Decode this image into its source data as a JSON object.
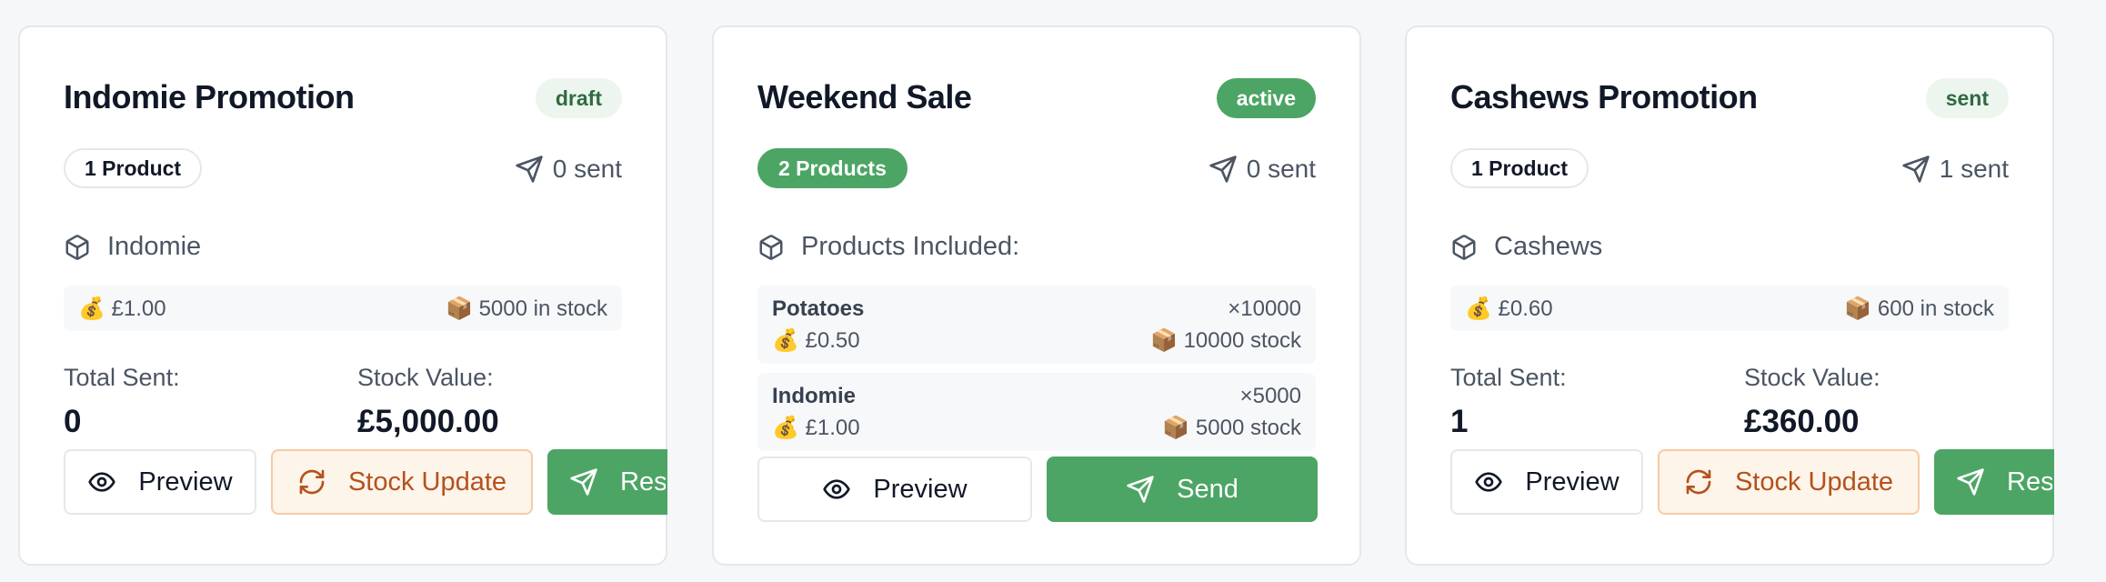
{
  "campaigns": [
    {
      "title": "Indomie Promotion",
      "status": "draft",
      "product_count": "1 Product",
      "sent": "0 sent",
      "product_name": "Indomie",
      "price": "💰 £1.00",
      "stock": "📦 5000 in stock",
      "total_sent_label": "Total Sent:",
      "total_sent": "0",
      "stock_value_label": "Stock Value:",
      "stock_value": "£5,000.00",
      "buttons": {
        "preview": "Preview",
        "stock_update": "Stock Update",
        "resend": "Resend"
      }
    },
    {
      "title": "Weekend Sale",
      "status": "active",
      "product_count": "2 Products",
      "sent": "0 sent",
      "products_label": "Products Included:",
      "products": [
        {
          "name": "Potatoes",
          "qty": "×10000",
          "price": "💰 £0.50",
          "stock": "📦 10000 stock"
        },
        {
          "name": "Indomie",
          "qty": "×5000",
          "price": "💰 £1.00",
          "stock": "📦 5000 stock"
        }
      ],
      "buttons": {
        "preview": "Preview",
        "send": "Send"
      }
    },
    {
      "title": "Cashews Promotion",
      "status": "sent",
      "product_count": "1 Product",
      "sent": "1 sent",
      "product_name": "Cashews",
      "price": "💰 £0.60",
      "stock": "📦 600 in stock",
      "total_sent_label": "Total Sent:",
      "total_sent": "1",
      "stock_value_label": "Stock Value:",
      "stock_value": "£360.00",
      "buttons": {
        "preview": "Preview",
        "stock_update": "Stock Update",
        "resend": "Resend"
      }
    }
  ],
  "colors": {
    "accent_green": "#4ca564",
    "badge_light_green": "#edf5ef",
    "stock_update_text": "#b4521d",
    "stock_update_bg": "#fdf4ea"
  },
  "icons": [
    "send-icon",
    "package-icon",
    "eye-icon",
    "refresh-icon"
  ]
}
